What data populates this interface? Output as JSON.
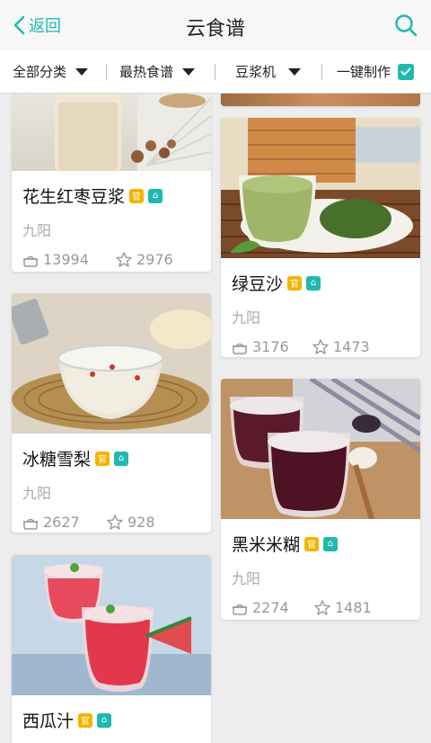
{
  "header": {
    "back_label": "返回",
    "title": "云食谱"
  },
  "filters": {
    "category": "全部分类",
    "sort": "最热食谱",
    "device": "豆浆机",
    "one_click": "一键制作"
  },
  "badges": {
    "official": "官",
    "home": "⌂"
  },
  "cards": [
    {
      "name": "花生红枣豆浆",
      "brand": "九阳",
      "views": "13994",
      "favs": "2976"
    },
    {
      "name": "绿豆沙",
      "brand": "九阳",
      "views": "3176",
      "favs": "1473"
    },
    {
      "name": "冰糖雪梨",
      "brand": "九阳",
      "views": "2627",
      "favs": "928"
    },
    {
      "name": "黑米米糊",
      "brand": "九阳",
      "views": "2274",
      "favs": "1481"
    },
    {
      "name": "西瓜汁",
      "brand": "九阳"
    }
  ]
}
